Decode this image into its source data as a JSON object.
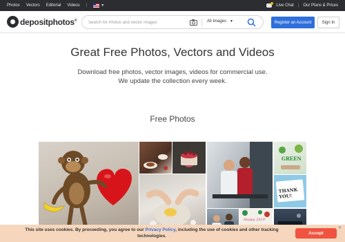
{
  "topbar": {
    "nav": [
      "Photos",
      "Vectors",
      "Editorial",
      "Videos"
    ],
    "separator": "|",
    "live_chat": "Live Chat",
    "plans": "Our Plans & Prices"
  },
  "header": {
    "logo_text": "depositphotos",
    "logo_reg": "®",
    "search_placeholder": "Search for Photos and Vector Images",
    "category": "All Images",
    "register": "Register an Account",
    "signin": "Sign In"
  },
  "hero": {
    "title": "Great Free Photos, Vectors and Videos",
    "subtitle_line1": "Download free photos, vector images, videos for commercial use.",
    "subtitle_line2": "We update the collection every week."
  },
  "section": {
    "title": "Free Photos"
  },
  "photos": {
    "green_text": "GREEN",
    "thanks_text": "THANK YOU!",
    "xmas_text": "Happy 2019"
  },
  "cookie": {
    "text_before": "This site uses cookies. By proceeding, you agree to our ",
    "link": "Privacy Policy",
    "text_after": ", including the use of cookies and other tracking technologies.",
    "accept": "Accept",
    "close": "✕"
  }
}
